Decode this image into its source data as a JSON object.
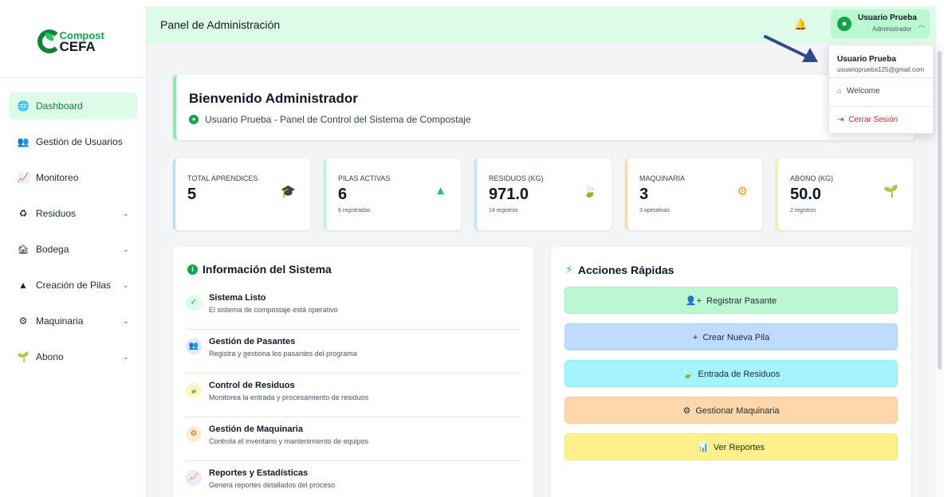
{
  "brand": {
    "line1": "Compost",
    "line2": "CEFA"
  },
  "sidebar": {
    "items": [
      {
        "label": "Dashboard",
        "icon": "globe-icon"
      },
      {
        "label": "Gestión de Usuarios",
        "icon": "users-icon"
      },
      {
        "label": "Monitoreo",
        "icon": "chart-line-icon"
      },
      {
        "label": "Residuos",
        "icon": "recycle-icon"
      },
      {
        "label": "Bodega",
        "icon": "warehouse-icon"
      },
      {
        "label": "Creación de Pilas",
        "icon": "mountain-icon"
      },
      {
        "label": "Maquinaria",
        "icon": "cogs-icon"
      },
      {
        "label": "Abono",
        "icon": "seedling-icon"
      }
    ]
  },
  "header": {
    "title": "Panel de Administración",
    "user_name": "Usuario Prueba",
    "user_role": "Administrador"
  },
  "dropdown": {
    "name": "Usuario Prueba",
    "email": "usuarioprueba125@gmail.com",
    "welcome": "Welcome",
    "logout": "Cerrar Sesión"
  },
  "welcome": {
    "title": "Bienvenido Administrador",
    "subtitle": "Usuario Prueba - Panel de Control del Sistema de Compostaje"
  },
  "stats": [
    {
      "label": "TOTAL APRENDICES",
      "value": "5",
      "note": "",
      "color": "#bfdbfe",
      "icon": "graduation-cap-icon"
    },
    {
      "label": "PILAS ACTIVAS",
      "value": "6",
      "note": "6 registradas",
      "color": "#bbf7d0",
      "icon": "mountain-icon"
    },
    {
      "label": "RESIDUOS (KG)",
      "value": "971.0",
      "note": "14 registros",
      "color": "#a5f3fc",
      "icon": "leaf-icon"
    },
    {
      "label": "MAQUINARIA",
      "value": "3",
      "note": "3 operativas",
      "color": "#fed7aa",
      "icon": "cogs-icon"
    },
    {
      "label": "ABONO (KG)",
      "value": "50.0",
      "note": "2 registros",
      "color": "#fef08a",
      "icon": "seedling-icon"
    }
  ],
  "info": {
    "title": "Información del Sistema",
    "items": [
      {
        "title": "Sistema Listo",
        "desc": "El sistema de compostaje está operativo"
      },
      {
        "title": "Gestión de Pasantes",
        "desc": "Registra y gestiona los pasantes del programa"
      },
      {
        "title": "Control de Residuos",
        "desc": "Monitorea la entrada y procesamiento de residuos"
      },
      {
        "title": "Gestión de Maquinaria",
        "desc": "Controla el inventario y mantenimiento de equipos"
      },
      {
        "title": "Reportes y Estadísticas",
        "desc": "Genera reportes detallados del proceso"
      }
    ]
  },
  "actions": {
    "title": "Acciones Rápidas",
    "buttons": [
      {
        "label": "Registrar Pasante",
        "color": "#bbf7d0"
      },
      {
        "label": "Crear Nueva Pila",
        "color": "#bfdbfe"
      },
      {
        "label": "Entrada de Residuos",
        "color": "#a5f3fc"
      },
      {
        "label": "Gestionar Maquinaria",
        "color": "#fed7aa"
      },
      {
        "label": "Ver Reportes",
        "color": "#fef08a"
      }
    ]
  }
}
